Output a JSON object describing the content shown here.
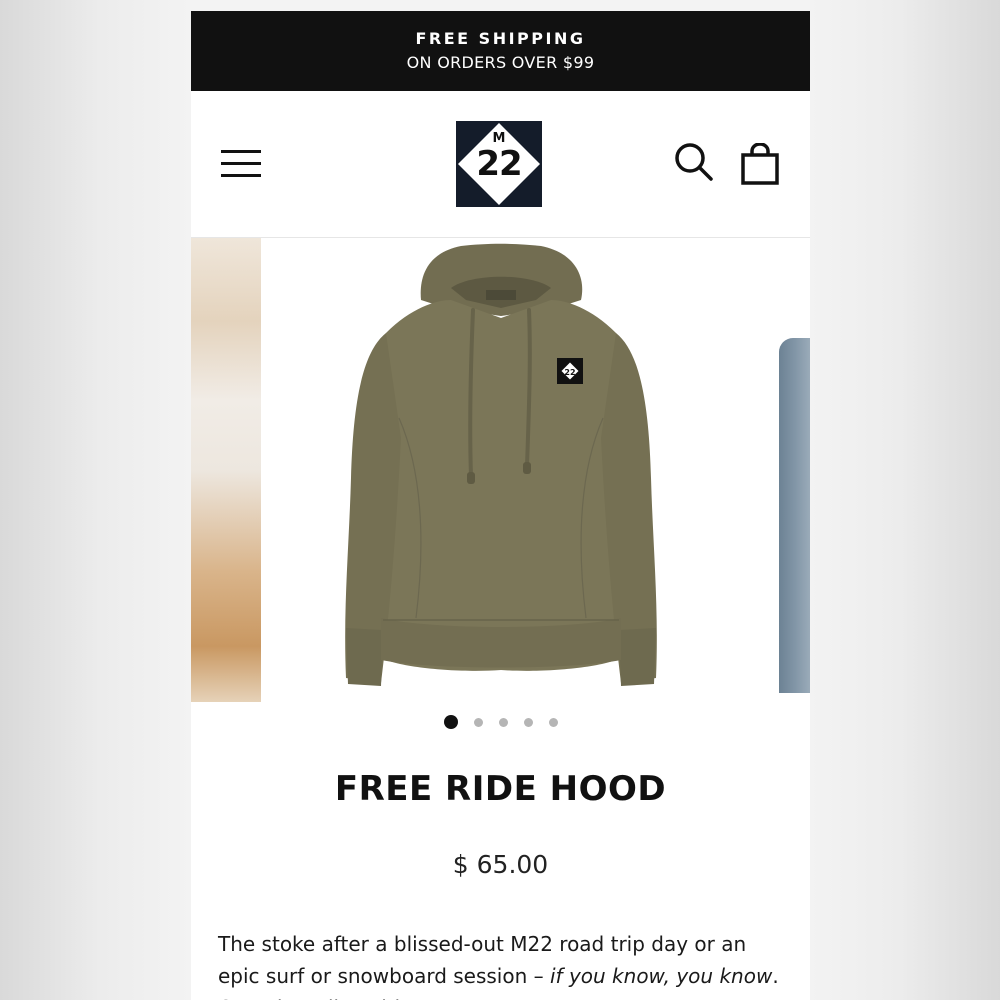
{
  "promo_bar": {
    "line1": "FREE SHIPPING",
    "line2": "ON ORDERS OVER $99"
  },
  "header": {
    "menu_icon": "hamburger-menu-icon",
    "logo": {
      "top_letter": "M",
      "number": "22"
    },
    "search_icon": "search-icon",
    "cart_icon": "shopping-bag-icon"
  },
  "gallery": {
    "image_count": 5,
    "active_index": 0
  },
  "product": {
    "title": "FREE RIDE HOOD",
    "price": "$ 65.00",
    "description": "The stoke after a blissed-out M22 road trip day or an epic surf or snowboard session – ",
    "description_italic": "if you know, you know",
    "description_end": ". Own that vibe with our cozy"
  },
  "colors": {
    "promo_bg": "#111111",
    "logo_bg": "#141c2a",
    "hoodie": "#7b7658",
    "dot_active": "#111111",
    "dot_inactive": "#b5b5b5"
  }
}
